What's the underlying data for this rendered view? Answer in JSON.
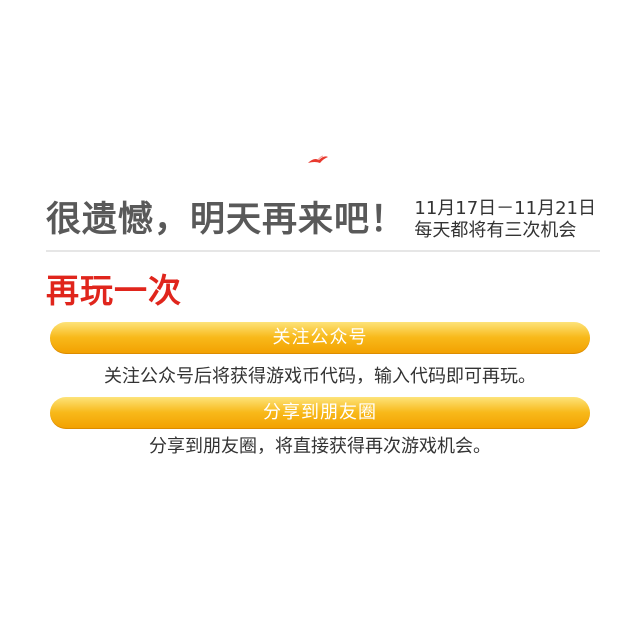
{
  "result": {
    "headline": "很遗憾，明天再来吧！",
    "date_range": "11月17日－11月21日",
    "daily_chances": "每天都将有三次机会"
  },
  "play_again": {
    "title": "再玩一次"
  },
  "options": {
    "follow": {
      "button_label": "关注公众号",
      "description": "关注公众号后将获得游戏币代码，输入代码即可再玩。"
    },
    "share": {
      "button_label": "分享到朋友圈",
      "description": "分享到朋友圈，将直接获得再次游戏机会。"
    }
  },
  "colors": {
    "headline": "#595959",
    "accent_red": "#e0251c",
    "button_gold": "#f8b91a"
  }
}
